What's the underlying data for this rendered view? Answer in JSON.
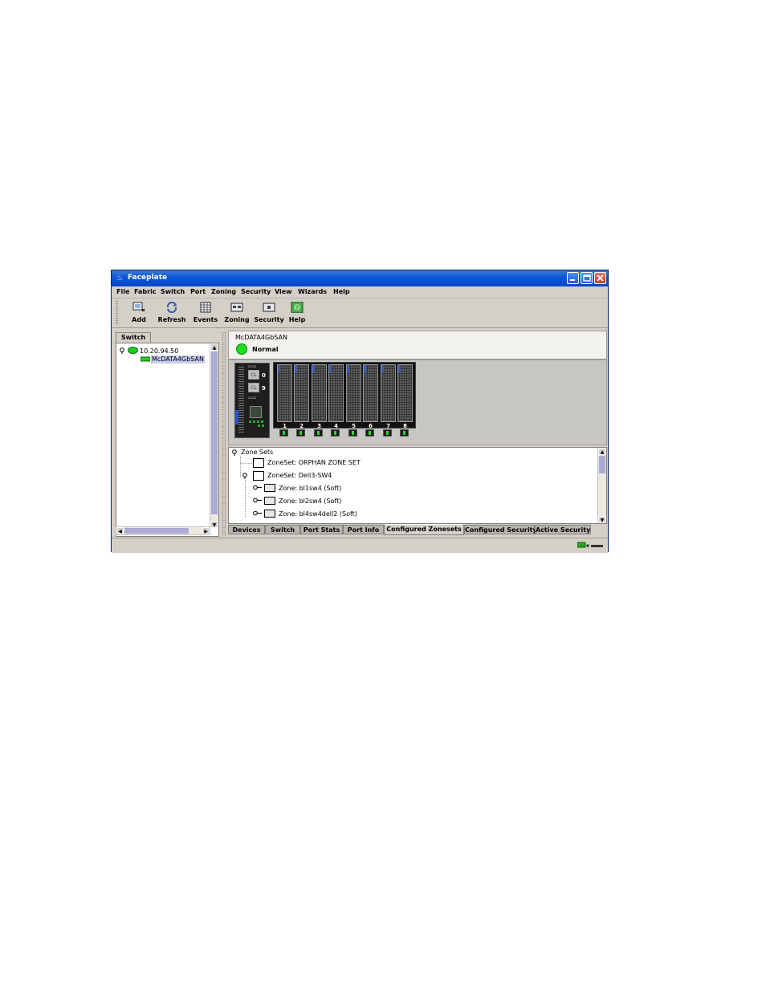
{
  "window": {
    "title": "Faceplate"
  },
  "menu": [
    "File",
    "Fabric",
    "Switch",
    "Port",
    "Zoning",
    "Security",
    "View",
    "Wizards",
    "Help"
  ],
  "toolbar": {
    "add": "Add",
    "refresh": "Refresh",
    "events": "Events",
    "zoning": "Zoning",
    "security": "Security",
    "help": "Help"
  },
  "left_panel": {
    "tab": "Switch",
    "tree": {
      "fabric_ip": "10.20.94.50",
      "switch_name": "McDATA4GbSAN"
    }
  },
  "faceplate": {
    "switch_name": "McDATA4GbSAN",
    "status": "Normal",
    "status_color": "#1adf1a",
    "mgmt": {
      "cl_label": "CL",
      "port0": "0",
      "port9": "9"
    },
    "ports": [
      "1",
      "2",
      "3",
      "4",
      "5",
      "6",
      "7",
      "8"
    ]
  },
  "zone_tree": {
    "root": "Zone Sets",
    "zoneset_orphan": "ZoneSet: ORPHAN ZONE SET",
    "zoneset_dell": "ZoneSet: Dell3-SW4",
    "zones": [
      "Zone: bl1sw4 (Soft)",
      "Zone: bl2sw4 (Soft)",
      "Zone: bl4sw4dell2 (Soft)"
    ]
  },
  "bottom_tabs": [
    "Devices",
    "Switch",
    "Port Stats",
    "Port Info",
    "Configured Zonesets",
    "Configured Security",
    "Active Security"
  ],
  "active_tab": "Configured Zonesets"
}
